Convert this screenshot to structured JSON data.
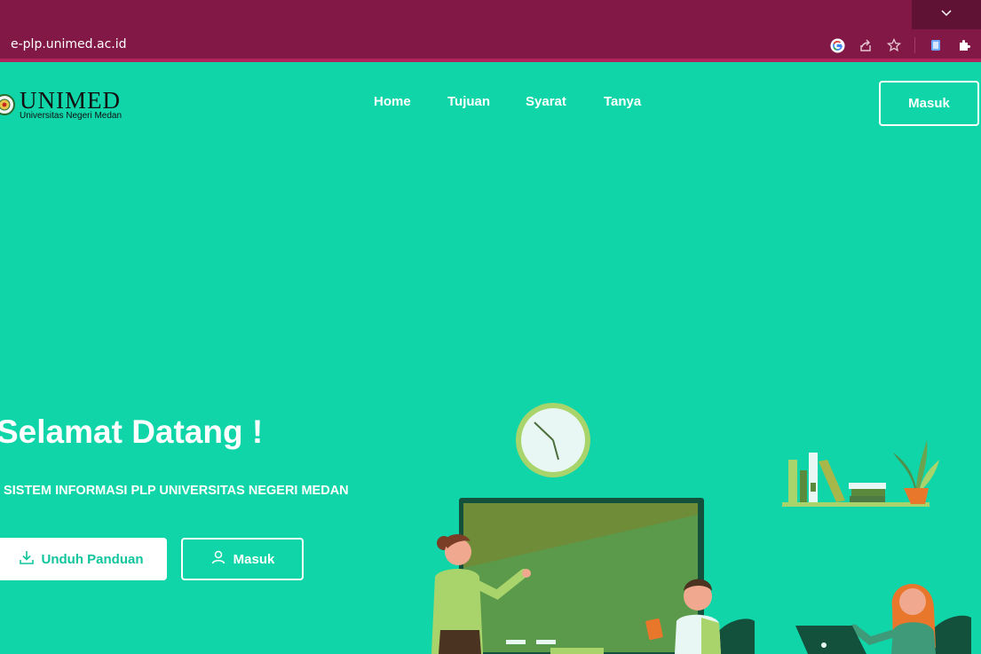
{
  "browser": {
    "url": "e-plp.unimed.ac.id",
    "icons": [
      "google-icon",
      "share-icon",
      "star-icon",
      "extension-doc-icon",
      "puzzle-icon"
    ],
    "tab_menu_icon": "chevron-down-icon",
    "colors": {
      "frame": "#821845",
      "accent": "#b0245e"
    }
  },
  "site": {
    "logo": {
      "name": "UNIMED",
      "subtitle": "Universitas Negeri Medan"
    },
    "nav": [
      {
        "label": "Home"
      },
      {
        "label": "Tujuan"
      },
      {
        "label": "Syarat"
      },
      {
        "label": "Tanya"
      }
    ],
    "login_label": "Masuk",
    "colors": {
      "primary": "#10d5a9"
    }
  },
  "hero": {
    "title": "Selamat Datang !",
    "subtitle": "I SISTEM INFORMASI PLP UNIVERSITAS NEGERI MEDAN",
    "download_label": "Unduh Panduan",
    "login_label": "Masuk"
  }
}
